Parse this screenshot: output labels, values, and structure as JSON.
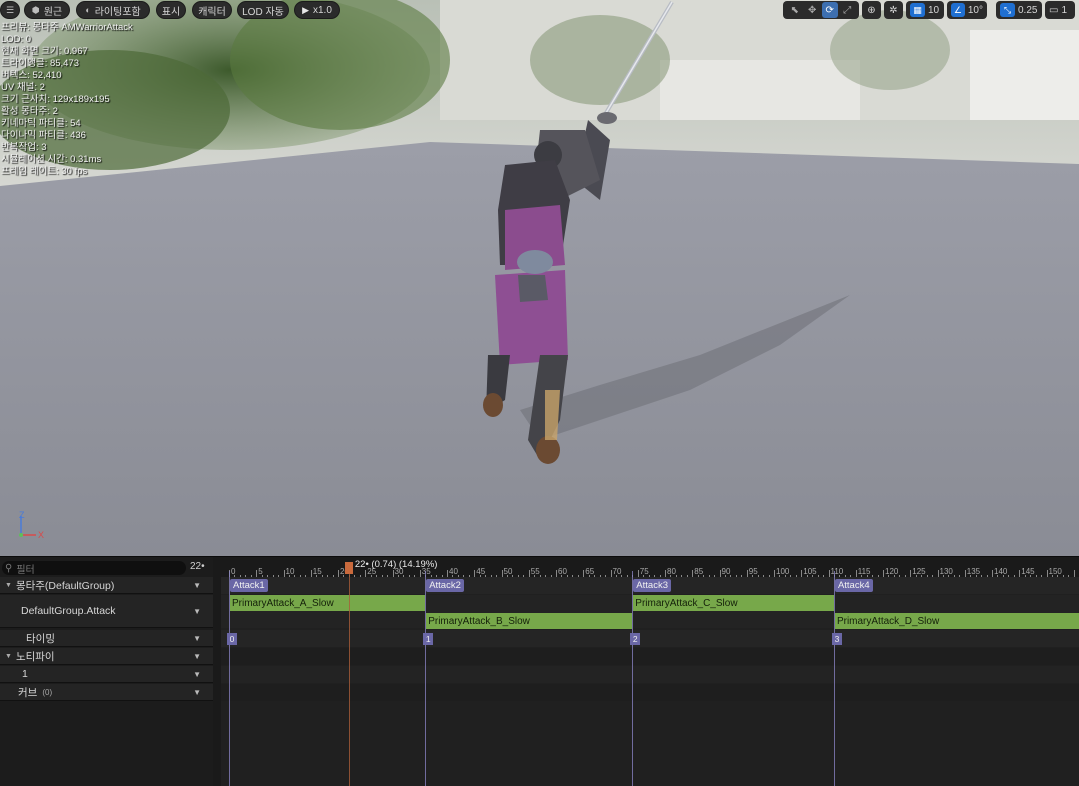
{
  "toolbar": {
    "perspective_label": "원근",
    "lighting_label": "라이팅포함",
    "show_label": "표시",
    "character_label": "캐릭터",
    "lod_label": "LOD 자동",
    "play_rate_label": "x1.0",
    "grid_snap_value": "10",
    "rotation_snap_value": "10°",
    "scale_snap_value": "0.25",
    "camera_speed_value": "1"
  },
  "stats": [
    "프리뷰: 몽타주 AMWarriorAttack",
    "LOD: 0",
    "현재 화면 크기: 0.967",
    "트라이앵글: 85,473",
    "버텍스: 52,410",
    "UV 채널: 2",
    "크기 근사치: 129x189x195",
    "활성 몽타주: 2",
    "키네마틱 파티클: 54",
    "다이나믹 파티클: 436",
    "반복작업: 3",
    "시뮬레이션 시간: 0.31ms",
    "프레임 레이트: 30 fps"
  ],
  "axis": {
    "z_label": "Z",
    "x_label": "X"
  },
  "panel": {
    "filter_placeholder": "필터",
    "current_frame": "22•",
    "rows": {
      "montage_group": "몽타주(DefaultGroup)",
      "slot": "DefaultGroup.Attack",
      "timing": "타이밍",
      "notify": "노티파이",
      "notify_track": "1",
      "curve": "커브",
      "curve_count": "(0)"
    }
  },
  "timeline": {
    "playhead_label": "22• (0.74) (14.19%)",
    "playhead_frame": 22,
    "tick_labels": [
      0,
      5,
      10,
      15,
      20,
      25,
      30,
      35,
      40,
      45,
      50,
      55,
      60,
      65,
      70,
      75,
      80,
      85,
      90,
      95,
      100,
      105,
      110,
      115,
      120,
      125,
      130,
      135,
      140,
      145,
      150
    ],
    "sections": [
      {
        "label": "Attack1",
        "frame": 0
      },
      {
        "label": "Attack2",
        "frame": 36
      },
      {
        "label": "Attack3",
        "frame": 74
      },
      {
        "label": "Attack4",
        "frame": 111
      }
    ],
    "segments": [
      {
        "label": "PrimaryAttack_A_Slow",
        "start": 0,
        "end": 36,
        "lane": 0
      },
      {
        "label": "PrimaryAttack_B_Slow",
        "start": 36,
        "end": 74,
        "lane": 1
      },
      {
        "label": "PrimaryAttack_C_Slow",
        "start": 74,
        "end": 111,
        "lane": 0
      },
      {
        "label": "PrimaryAttack_D_Slow",
        "start": 111,
        "end": 157,
        "lane": 1
      }
    ],
    "timing_markers": [
      {
        "label": "0",
        "frame": 0
      },
      {
        "label": "1",
        "frame": 36
      },
      {
        "label": "2",
        "frame": 74
      },
      {
        "label": "3",
        "frame": 111
      }
    ]
  },
  "colors": {
    "accent_blue": "#1f6fd1",
    "section_purple": "#6a67a6",
    "segment_green": "#77a84a",
    "playhead_orange": "#c96a3d"
  }
}
